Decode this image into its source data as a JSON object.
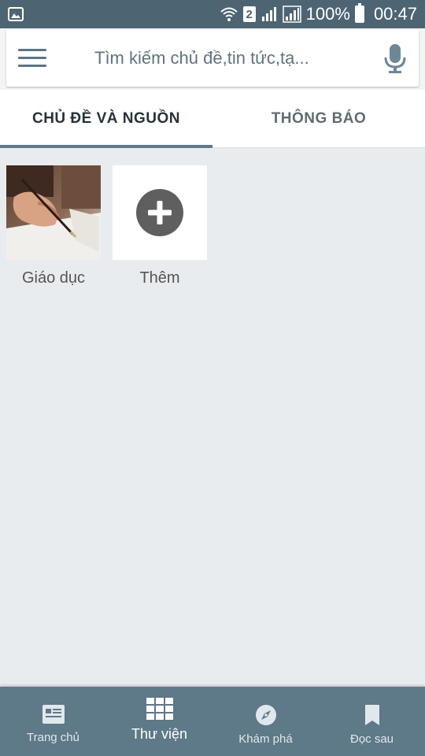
{
  "status_bar": {
    "sim_slot": "2",
    "battery": "100%",
    "time": "00:47"
  },
  "search": {
    "placeholder": "Tìm kiếm chủ đề,tin tức,tạ..."
  },
  "tabs": [
    {
      "label": "CHỦ ĐỀ VÀ NGUỒN",
      "active": true
    },
    {
      "label": "THÔNG BÁO",
      "active": false
    }
  ],
  "tiles": [
    {
      "label": "Giáo dục"
    },
    {
      "label": "Thêm"
    }
  ],
  "bottom_nav": [
    {
      "label": "Trang chủ",
      "icon": "news-icon"
    },
    {
      "label": "Thư viện",
      "icon": "grid-icon",
      "active": true
    },
    {
      "label": "Khám phá",
      "icon": "compass-icon"
    },
    {
      "label": "Đọc sau",
      "icon": "bookmark-icon"
    }
  ],
  "colors": {
    "primary": "#5e7988",
    "status_bar": "#4d6473",
    "background": "#e9ecef"
  }
}
